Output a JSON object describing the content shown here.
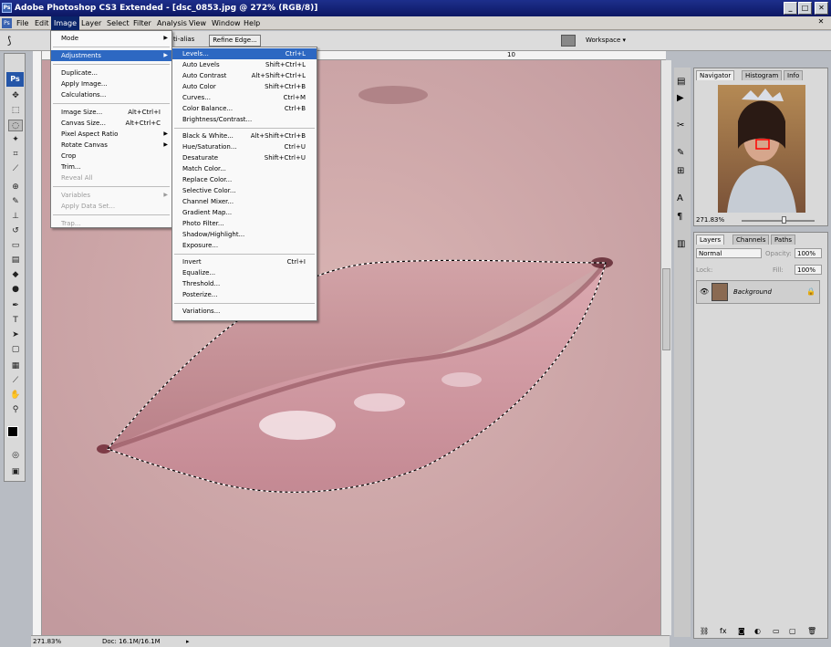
{
  "titlebar": {
    "title": "Adobe Photoshop CS3 Extended - [dsc_0853.jpg @ 272% (RGB/8)]",
    "min": "_",
    "max": "□",
    "close": "✕"
  },
  "menubar": {
    "items": [
      {
        "label": "File",
        "active": false
      },
      {
        "label": "Edit",
        "active": false
      },
      {
        "label": "Image",
        "active": true
      },
      {
        "label": "Layer",
        "active": false
      },
      {
        "label": "Select",
        "active": false
      },
      {
        "label": "Filter",
        "active": false
      },
      {
        "label": "Analysis",
        "active": false
      },
      {
        "label": "View",
        "active": false
      },
      {
        "label": "Window",
        "active": false
      },
      {
        "label": "Help",
        "active": false
      }
    ],
    "close": "✕"
  },
  "optionsbar": {
    "antialias": "ti-alias",
    "refine_edge": "Refine Edge...",
    "workspace": "Workspace ▾"
  },
  "image_menu": {
    "items": [
      {
        "label": "Mode",
        "shortcut": "",
        "submenu": true,
        "disabled": false,
        "highlighted": false,
        "sep_after": true
      },
      {
        "label": "Adjustments",
        "shortcut": "",
        "submenu": true,
        "disabled": false,
        "highlighted": true,
        "sep_after": true
      },
      {
        "label": "Duplicate...",
        "shortcut": "",
        "submenu": false,
        "disabled": false,
        "highlighted": false,
        "sep_after": false
      },
      {
        "label": "Apply Image...",
        "shortcut": "",
        "submenu": false,
        "disabled": false,
        "highlighted": false,
        "sep_after": false
      },
      {
        "label": "Calculations...",
        "shortcut": "",
        "submenu": false,
        "disabled": false,
        "highlighted": false,
        "sep_after": true
      },
      {
        "label": "Image Size...",
        "shortcut": "Alt+Ctrl+I",
        "submenu": false,
        "disabled": false,
        "highlighted": false,
        "sep_after": false
      },
      {
        "label": "Canvas Size...",
        "shortcut": "Alt+Ctrl+C",
        "submenu": false,
        "disabled": false,
        "highlighted": false,
        "sep_after": false
      },
      {
        "label": "Pixel Aspect Ratio",
        "shortcut": "",
        "submenu": true,
        "disabled": false,
        "highlighted": false,
        "sep_after": false
      },
      {
        "label": "Rotate Canvas",
        "shortcut": "",
        "submenu": true,
        "disabled": false,
        "highlighted": false,
        "sep_after": false
      },
      {
        "label": "Crop",
        "shortcut": "",
        "submenu": false,
        "disabled": false,
        "highlighted": false,
        "sep_after": false
      },
      {
        "label": "Trim...",
        "shortcut": "",
        "submenu": false,
        "disabled": false,
        "highlighted": false,
        "sep_after": false
      },
      {
        "label": "Reveal All",
        "shortcut": "",
        "submenu": false,
        "disabled": true,
        "highlighted": false,
        "sep_after": true
      },
      {
        "label": "Variables",
        "shortcut": "",
        "submenu": true,
        "disabled": true,
        "highlighted": false,
        "sep_after": false
      },
      {
        "label": "Apply Data Set...",
        "shortcut": "",
        "submenu": false,
        "disabled": true,
        "highlighted": false,
        "sep_after": true
      },
      {
        "label": "Trap...",
        "shortcut": "",
        "submenu": false,
        "disabled": true,
        "highlighted": false,
        "sep_after": false
      }
    ]
  },
  "adjust_menu": {
    "items": [
      {
        "label": "Levels...",
        "shortcut": "Ctrl+L",
        "highlighted": true,
        "sep_after": false
      },
      {
        "label": "Auto Levels",
        "shortcut": "Shift+Ctrl+L",
        "highlighted": false,
        "sep_after": false
      },
      {
        "label": "Auto Contrast",
        "shortcut": "Alt+Shift+Ctrl+L",
        "highlighted": false,
        "sep_after": false
      },
      {
        "label": "Auto Color",
        "shortcut": "Shift+Ctrl+B",
        "highlighted": false,
        "sep_after": false
      },
      {
        "label": "Curves...",
        "shortcut": "Ctrl+M",
        "highlighted": false,
        "sep_after": false
      },
      {
        "label": "Color Balance...",
        "shortcut": "Ctrl+B",
        "highlighted": false,
        "sep_after": false
      },
      {
        "label": "Brightness/Contrast...",
        "shortcut": "",
        "highlighted": false,
        "sep_after": true
      },
      {
        "label": "Black & White...",
        "shortcut": "Alt+Shift+Ctrl+B",
        "highlighted": false,
        "sep_after": false
      },
      {
        "label": "Hue/Saturation...",
        "shortcut": "Ctrl+U",
        "highlighted": false,
        "sep_after": false
      },
      {
        "label": "Desaturate",
        "shortcut": "Shift+Ctrl+U",
        "highlighted": false,
        "sep_after": false
      },
      {
        "label": "Match Color...",
        "shortcut": "",
        "highlighted": false,
        "sep_after": false
      },
      {
        "label": "Replace Color...",
        "shortcut": "",
        "highlighted": false,
        "sep_after": false
      },
      {
        "label": "Selective Color...",
        "shortcut": "",
        "highlighted": false,
        "sep_after": false
      },
      {
        "label": "Channel Mixer...",
        "shortcut": "",
        "highlighted": false,
        "sep_after": false
      },
      {
        "label": "Gradient Map...",
        "shortcut": "",
        "highlighted": false,
        "sep_after": false
      },
      {
        "label": "Photo Filter...",
        "shortcut": "",
        "highlighted": false,
        "sep_after": false
      },
      {
        "label": "Shadow/Highlight...",
        "shortcut": "",
        "highlighted": false,
        "sep_after": false
      },
      {
        "label": "Exposure...",
        "shortcut": "",
        "highlighted": false,
        "sep_after": true
      },
      {
        "label": "Invert",
        "shortcut": "Ctrl+I",
        "highlighted": false,
        "sep_after": false
      },
      {
        "label": "Equalize...",
        "shortcut": "",
        "highlighted": false,
        "sep_after": false
      },
      {
        "label": "Threshold...",
        "shortcut": "",
        "highlighted": false,
        "sep_after": false
      },
      {
        "label": "Posterize...",
        "shortcut": "",
        "highlighted": false,
        "sep_after": true
      },
      {
        "label": "Variations...",
        "shortcut": "",
        "highlighted": false,
        "sep_after": false
      }
    ]
  },
  "ruler": {
    "mark": "10"
  },
  "navigator": {
    "tabs": [
      {
        "label": "Navigator",
        "active": true
      },
      {
        "label": "Histogram",
        "active": false
      },
      {
        "label": "Info",
        "active": false
      }
    ],
    "zoom": "271.83%"
  },
  "layers": {
    "tabs": [
      {
        "label": "Layers",
        "active": true
      },
      {
        "label": "Channels",
        "active": false
      },
      {
        "label": "Paths",
        "active": false
      }
    ],
    "blend_mode": "Normal",
    "opacity_label": "Opacity:",
    "opacity_value": "100%",
    "lock_label": "Lock:",
    "fill_label": "Fill:",
    "fill_value": "100%",
    "layer_name": "Background"
  },
  "status": {
    "zoom": "271.83%",
    "doc": "Doc: 16.1M/16.1M"
  },
  "colors": {
    "title": "#0d1763",
    "highlight": "#2d68c2",
    "skin": "#caa6a8"
  }
}
